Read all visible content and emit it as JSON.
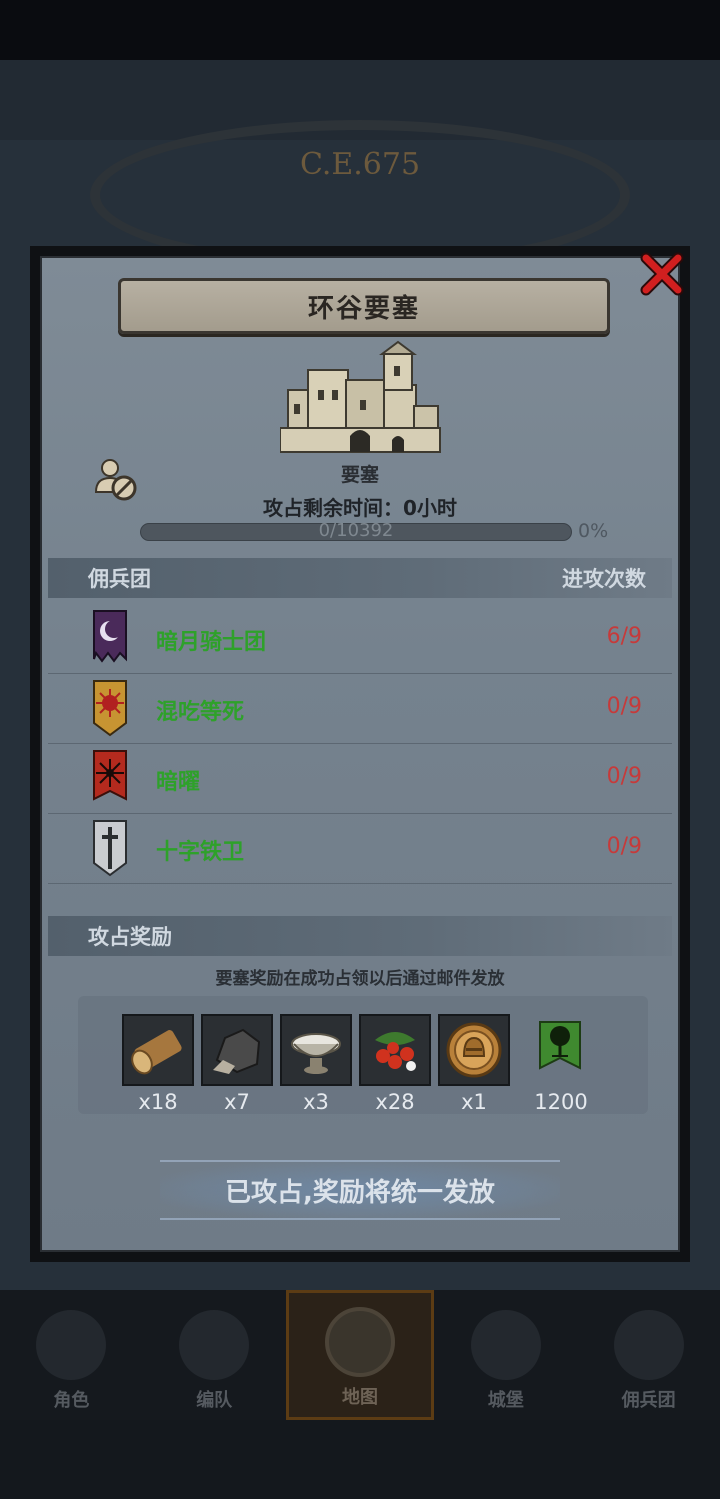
{
  "background": {
    "era": "C.E.675",
    "nav": [
      {
        "label": "角色",
        "active": false
      },
      {
        "label": "编队",
        "active": false
      },
      {
        "label": "地图",
        "active": true
      },
      {
        "label": "城堡",
        "active": false
      },
      {
        "label": "佣兵团",
        "active": false
      }
    ]
  },
  "modal": {
    "title": "环谷要塞",
    "fort_type": "要塞",
    "capture_time": "攻占剩余时间：0小时",
    "progress": {
      "text": "0/10392",
      "percent": "0%",
      "value": 0
    },
    "merc_header": {
      "left": "佣兵团",
      "right": "进攻次数"
    },
    "mercenaries": [
      {
        "name": "暗月骑士团",
        "count": "6/9",
        "banner": "moon-banner"
      },
      {
        "name": "混吃等死",
        "count": "0/9",
        "banner": "sun-banner"
      },
      {
        "name": "暗曜",
        "count": "0/9",
        "banner": "star-banner"
      },
      {
        "name": "十字铁卫",
        "count": "0/9",
        "banner": "sword-banner"
      }
    ],
    "reward_header": "攻占奖励",
    "reward_note": "要塞奖励在成功占领以后通过邮件发放",
    "rewards": [
      {
        "icon": "wood-log-icon",
        "qty": "x18"
      },
      {
        "icon": "ore-stone-icon",
        "qty": "x7"
      },
      {
        "icon": "silver-bowl-icon",
        "qty": "x3"
      },
      {
        "icon": "berries-icon",
        "qty": "x28"
      },
      {
        "icon": "helmet-medal-icon",
        "qty": "x1"
      },
      {
        "icon": "guild-tree-banner-icon",
        "qty": "1200"
      }
    ],
    "claim_label": "已攻占,奖励将统一发放"
  },
  "colors": {
    "merc_name": "#2ea12a",
    "attack_count": "#c63a3a",
    "close": "#d11f1f"
  }
}
